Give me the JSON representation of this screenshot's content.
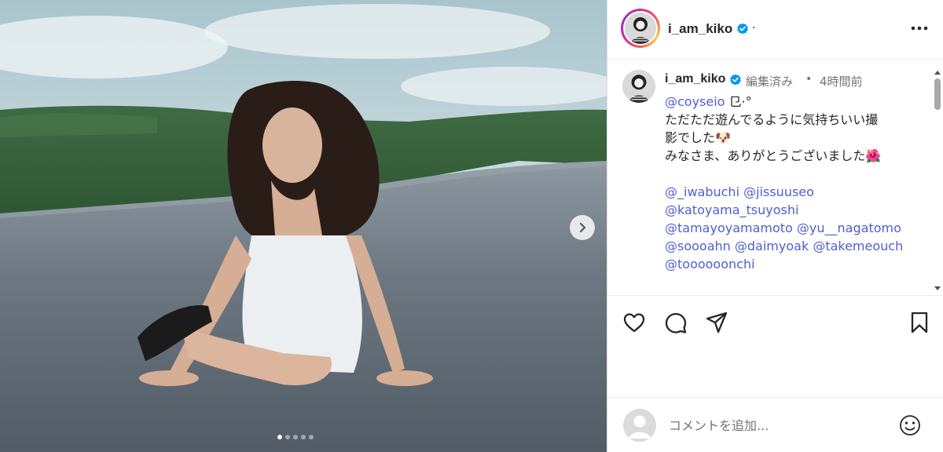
{
  "post": {
    "author": "i_am_kiko",
    "verified": true,
    "carousel_total": 5,
    "carousel_index": 1
  },
  "comment": {
    "author": "i_am_kiko",
    "edited_label": "編集済み",
    "separator": "•",
    "timestamp": "4時間前",
    "lines": [
      {
        "type": "text",
        "parts": [
          {
            "mention": "@coyseio"
          },
          {
            "text": " ⺋·°"
          }
        ]
      },
      {
        "type": "text",
        "parts": [
          {
            "text": "ただただ遊んでるように気持ちいい撮"
          }
        ]
      },
      {
        "type": "text",
        "parts": [
          {
            "text": "影でした🐶"
          }
        ]
      },
      {
        "type": "text",
        "parts": [
          {
            "text": "みなさま、ありがとうございました🌺"
          }
        ]
      },
      {
        "type": "blank"
      },
      {
        "type": "text",
        "parts": [
          {
            "mention": "@_iwabuchi"
          },
          {
            "text": " "
          },
          {
            "mention": "@jissuuseo"
          }
        ]
      },
      {
        "type": "text",
        "parts": [
          {
            "mention": "@katoyama_tsuyoshi"
          }
        ]
      },
      {
        "type": "text",
        "parts": [
          {
            "mention": "@tamayoyamamoto"
          },
          {
            "text": " "
          },
          {
            "mention": "@yu__nagatomo"
          }
        ]
      },
      {
        "type": "text",
        "parts": [
          {
            "mention": "@soooahn"
          },
          {
            "text": " "
          },
          {
            "mention": "@daimyoak"
          },
          {
            "text": " "
          },
          {
            "mention": "@takemeouch"
          }
        ]
      },
      {
        "type": "text",
        "parts": [
          {
            "mention": "@toooooonchi"
          }
        ]
      }
    ]
  },
  "add_comment": {
    "placeholder": "コメントを追加..."
  },
  "colors": {
    "mention": "#4f5ed0",
    "verified": "#0095f6",
    "muted": "#737373",
    "text": "#262626"
  },
  "icons": [
    "chevron-right-icon",
    "more-icon",
    "verified-icon",
    "heart-icon",
    "comment-icon",
    "share-icon",
    "bookmark-icon",
    "emoji-icon"
  ]
}
